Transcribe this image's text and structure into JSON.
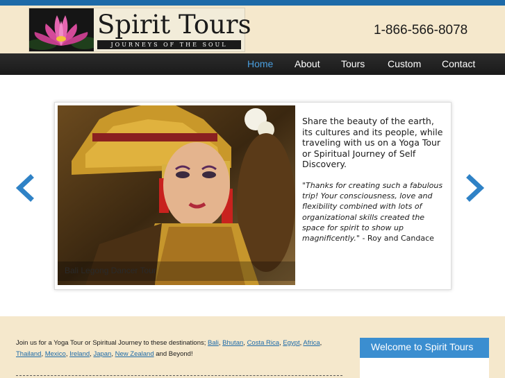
{
  "header": {
    "brand_title": "Spirit Tours",
    "brand_tagline": "JOURNEYS OF THE SOUL",
    "phone": "1-866-566-8078"
  },
  "nav": {
    "items": [
      {
        "label": "Home",
        "active": true
      },
      {
        "label": "About",
        "active": false
      },
      {
        "label": "Tours",
        "active": false
      },
      {
        "label": "Custom",
        "active": false
      },
      {
        "label": "Contact",
        "active": false
      }
    ]
  },
  "slider": {
    "photo_caption": "Bali Legong Dancer Tour",
    "intro": "Share the beauty of the earth, its cultures and its people, while traveling with us on a Yoga Tour or Spiritual Journey of Self Discovery.",
    "quote": "\"Thanks for creating such a fabulous trip! Your consciousness, love and flexibility combined with lots of organizational skills created the space for spirit to show up magnificently.\"",
    "quote_author": " - Roy and Candace",
    "prev_icon": "chevron-left-icon",
    "next_icon": "chevron-right-icon"
  },
  "destinations": {
    "intro": "Join us for a Yoga Tour or Spiritual Journey to these destinations; ",
    "links": [
      "Bali",
      "Bhutan",
      "Costa Rica",
      "Egypt",
      "Africa",
      "Thailand",
      "Mexico",
      "Ireland",
      "Japan",
      "New Zealand"
    ],
    "outro": " and Beyond!"
  },
  "sidebar": {
    "welcome_title": "Welcome to Spirit Tours"
  },
  "colors": {
    "accent": "#1d6aa8",
    "nav_active": "#4a9fe0",
    "background": "#f5e8cc",
    "nav_bg": "#222222"
  }
}
